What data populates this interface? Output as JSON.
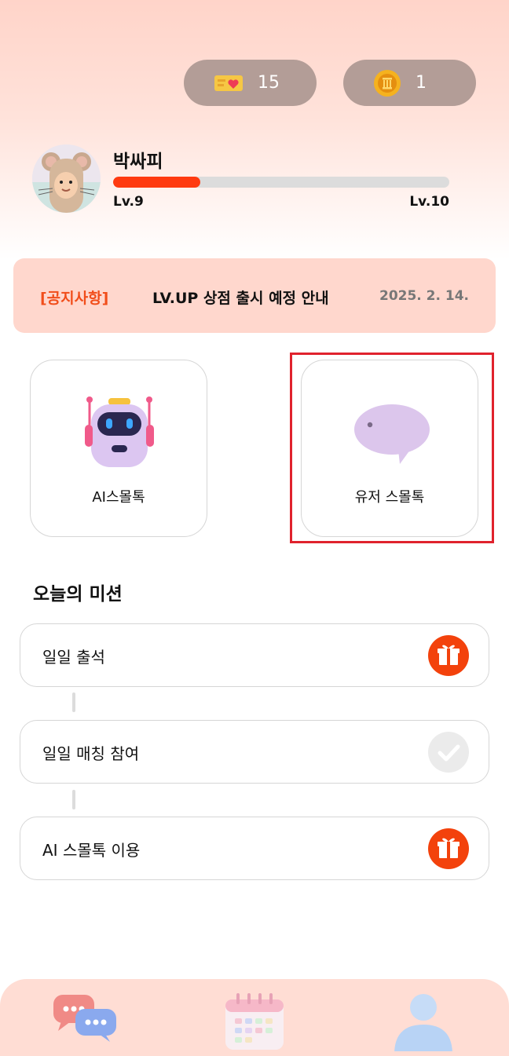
{
  "header": {
    "ticket_count": "15",
    "coin_count": "1"
  },
  "profile": {
    "name": "박싸피",
    "level_current": "Lv.9",
    "level_next": "Lv.10",
    "xp_progress": 0.26
  },
  "notice": {
    "tag": "[공지사항]",
    "title": "LV.UP 상점 출시 예정 안내",
    "date": "2025. 2. 14."
  },
  "cards": {
    "ai_label": "AI스몰톡",
    "user_label": "유저 스몰톡"
  },
  "missions": {
    "title": "오늘의 미션",
    "items": [
      {
        "label": "일일 출석",
        "status": "gift"
      },
      {
        "label": "일일 매칭 참여",
        "status": "done"
      },
      {
        "label": "AI 스몰톡 이용",
        "status": "gift"
      }
    ]
  },
  "colors": {
    "accent": "#ff3a10",
    "highlight": "#e0222d",
    "pill_bg": "#b39d97",
    "nav_bg": "#ffddd4"
  },
  "icons": {
    "ticket": "ticket-heart-icon",
    "coin": "coin-icon",
    "ai": "robot-icon",
    "user": "speech-bubble-icon",
    "gift": "gift-icon",
    "check": "check-icon",
    "nav_chat": "chat-bubbles-icon",
    "nav_calendar": "calendar-icon",
    "nav_profile": "person-icon"
  }
}
